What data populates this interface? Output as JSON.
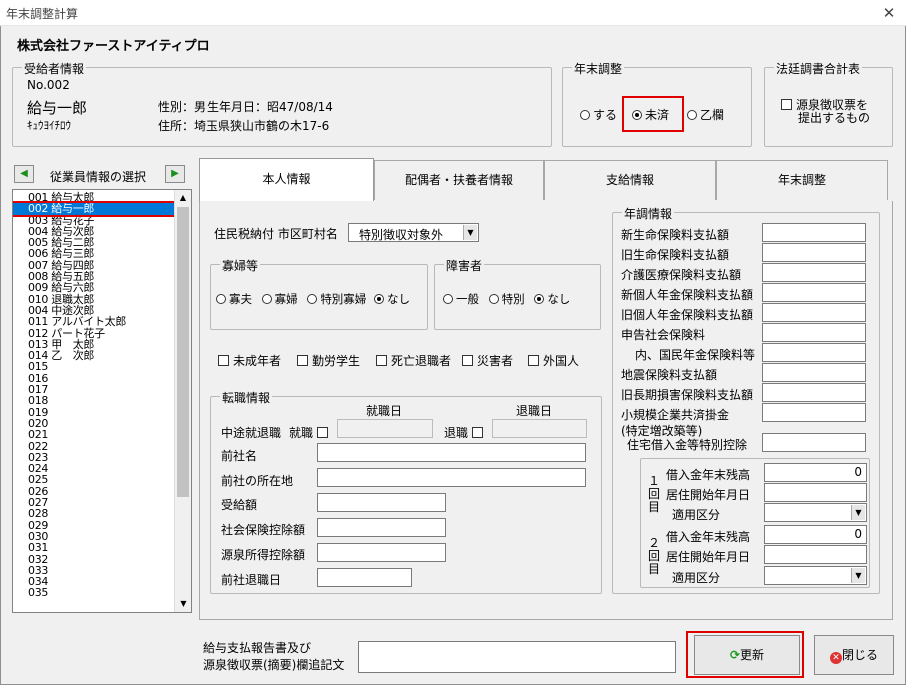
{
  "window": {
    "title": "年末調整計算",
    "close_glyph": "✕"
  },
  "company": "株式会社ファーストアイティプロ",
  "recipient": {
    "legend": "受給者情報",
    "number": "No.002",
    "name": "給与一郎",
    "kana": "ｷｭｳﾖｲﾁﾛｳ",
    "gender_label": "性別：",
    "gender": "男",
    "birth_label": "生年月日：",
    "birth": "昭47/08/14",
    "address_label": "住所：",
    "address": "埼玉県狭山市鶴の木17-6"
  },
  "year_end": {
    "legend": "年末調整",
    "opt_do": "する",
    "opt_done": "未済",
    "opt_otsu": "乙欄"
  },
  "statutory": {
    "legend": "法廷調書合計表",
    "checkbox_label_1": "源泉徴収票を",
    "checkbox_label_2": "提出するもの"
  },
  "employee_select": {
    "title": "従業員情報の選択",
    "left_arrow": "◀",
    "right_arrow": "▶",
    "items": [
      "001 給与太郎",
      "002 給与一郎",
      "003 給与花子",
      "004 給与次郎",
      "005 給与二郎",
      "006 給与三郎",
      "007 給与四郎",
      "008 給与五郎",
      "009 給与六郎",
      "010 退職太郎",
      "004 中途次郎",
      "011 アルバイト太郎",
      "012 パート花子",
      "013 甲　太郎",
      "014 乙　次郎",
      "015",
      "016",
      "017",
      "018",
      "019",
      "020",
      "021",
      "022",
      "023",
      "024",
      "025",
      "026",
      "027",
      "028",
      "029",
      "030",
      "031",
      "032",
      "033",
      "034",
      "035"
    ],
    "selected_index": 1
  },
  "tabs": [
    "本人情報",
    "配偶者・扶養者情報",
    "支給情報",
    "年末調整"
  ],
  "personal": {
    "resident_tax_label": "住民税納付 市区町村名",
    "resident_tax_value": "特別徴収対象外",
    "widow": {
      "legend": "寡婦等",
      "options": [
        "寡夫",
        "寡婦",
        "特別寡婦",
        "なし"
      ]
    },
    "disability": {
      "legend": "障害者",
      "options": [
        "一般",
        "特別",
        "なし"
      ]
    },
    "checks": [
      "未成年者",
      "勤労学生",
      "死亡退職者",
      "災害者",
      "外国人"
    ],
    "transfer": {
      "legend": "転職情報",
      "hire_date_header": "就職日",
      "retire_date_header": "退職日",
      "midway_label": "中途就退職",
      "hired_label": "就職",
      "retired_label": "退職",
      "fields": [
        "前社名",
        "前社の所在地",
        "受給額",
        "社会保険控除額",
        "源泉所得控除額",
        "前社退職日"
      ]
    }
  },
  "annual": {
    "legend": "年調情報",
    "fields": [
      "新生命保険料支払額",
      "旧生命保険料支払額",
      "介護医療保険料支払額",
      "新個人年金保険料支払額",
      "旧個人年金保険料支払額",
      "申告社会保険料",
      "内、国民年金保険料等",
      "地震保険料支払額",
      "旧長期損害保険料支払額",
      "小規模企業共済掛金"
    ],
    "special_label": "(特定増改築等)",
    "housing_label": "住宅借入金等特別控除",
    "loan1": {
      "side": "１回目",
      "balance_label": "借入金年末残高",
      "balance": "0",
      "start_label": "居住開始年月日",
      "type_label": "適用区分"
    },
    "loan2": {
      "side": "２回目",
      "balance_label": "借入金年末残高",
      "balance": "0",
      "start_label": "居住開始年月日",
      "type_label": "適用区分"
    }
  },
  "footer": {
    "remark_label_1": "給与支払報告書及び",
    "remark_label_2": "源泉徴収票(摘要)欄追記文",
    "update": "更新",
    "close": "閉じる"
  }
}
